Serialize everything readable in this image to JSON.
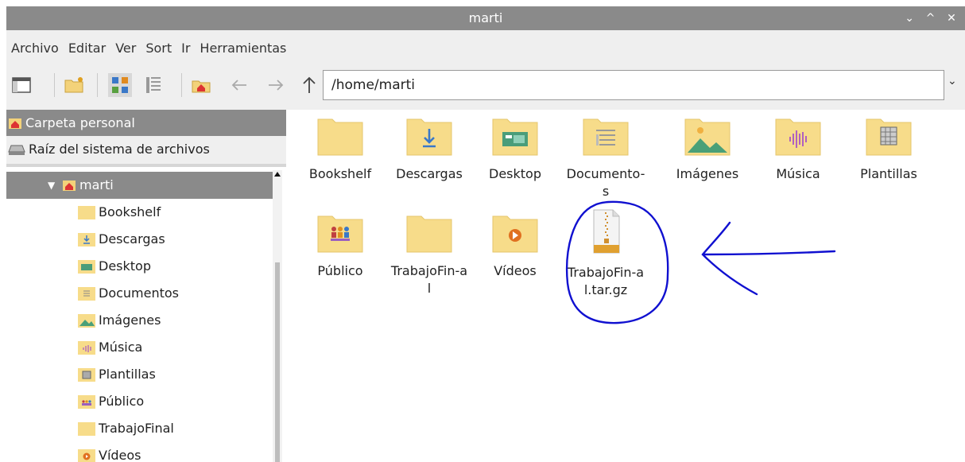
{
  "window": {
    "title": "marti",
    "controls": [
      "⌄",
      "^",
      "✕"
    ]
  },
  "menu": [
    "Archivo",
    "Editar",
    "Ver",
    "Sort",
    "Ir",
    "Herramientas"
  ],
  "address": {
    "path": "/home/marti"
  },
  "places": [
    {
      "label": "Carpeta personal",
      "icon": "home-icon",
      "selected": true
    },
    {
      "label": "Raíz del sistema de archivos",
      "icon": "drive-icon",
      "selected": false
    }
  ],
  "tree": {
    "root": "marti",
    "items": [
      "Bookshelf",
      "Descargas",
      "Desktop",
      "Documentos",
      "Imágenes",
      "Música",
      "Plantillas",
      "Público",
      "TrabajoFinal",
      "Vídeos"
    ]
  },
  "files": [
    {
      "label": "Bookshelf",
      "type": "folder"
    },
    {
      "label": "Descargas",
      "type": "folder-download"
    },
    {
      "label": "Desktop",
      "type": "folder-desktop"
    },
    {
      "label": "Documento-s",
      "type": "folder-documents"
    },
    {
      "label": "Imágenes",
      "type": "folder-pictures"
    },
    {
      "label": "Música",
      "type": "folder-music"
    },
    {
      "label": "Plantillas",
      "type": "folder-templates"
    },
    {
      "label": "Público",
      "type": "folder-public"
    },
    {
      "label": "TrabajoFin-al",
      "type": "folder"
    },
    {
      "label": "Vídeos",
      "type": "folder-videos"
    },
    {
      "label": "TrabajoFin-al.tar.gz",
      "type": "archive"
    }
  ]
}
